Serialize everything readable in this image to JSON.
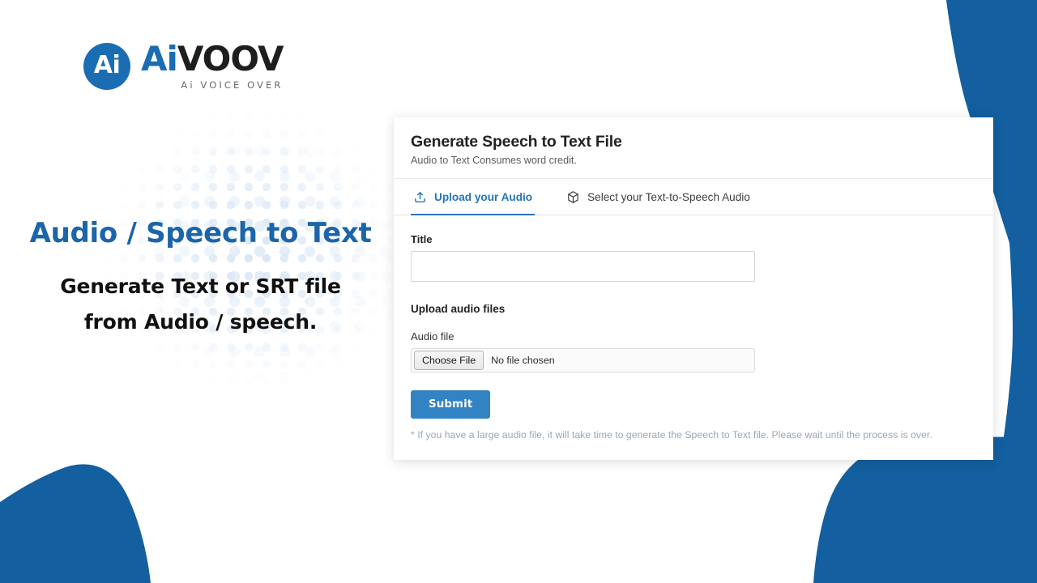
{
  "brand": {
    "badge_text": "Ai",
    "name_part1": "Ai",
    "name_part2": "VOOV",
    "tagline": "Ai VOICE OVER",
    "primary_color": "#1b6db3",
    "dark_color": "#1e1e1e"
  },
  "hero": {
    "headline": "Audio / Speech to Text",
    "subhead_line1": "Generate Text or SRT file",
    "subhead_line2": "from Audio / speech.",
    "headline_color": "#1b65aa"
  },
  "card": {
    "title": "Generate Speech to Text File",
    "subtitle": "Audio to Text Consumes word credit.",
    "tabs": [
      {
        "label": "Upload your Audio",
        "icon": "upload-icon",
        "active": true
      },
      {
        "label": "Select your Text-to-Speech Audio",
        "icon": "cube-icon",
        "active": false
      }
    ],
    "form": {
      "title_label": "Title",
      "title_value": "",
      "title_placeholder": "",
      "upload_section_label": "Upload audio files",
      "audio_file_label": "Audio file",
      "choose_file_button": "Choose File",
      "file_status": "No file chosen",
      "submit_label": "Submit",
      "note": "* If you have a large audio file, it will take time to generate the Speech to Text file. Please wait until the process is over.",
      "accent_color": "#3183c3",
      "note_color": "#9aa8b4"
    }
  },
  "decor": {
    "blob_color": "#135f9f",
    "dot_color": "#cfe0f2"
  }
}
